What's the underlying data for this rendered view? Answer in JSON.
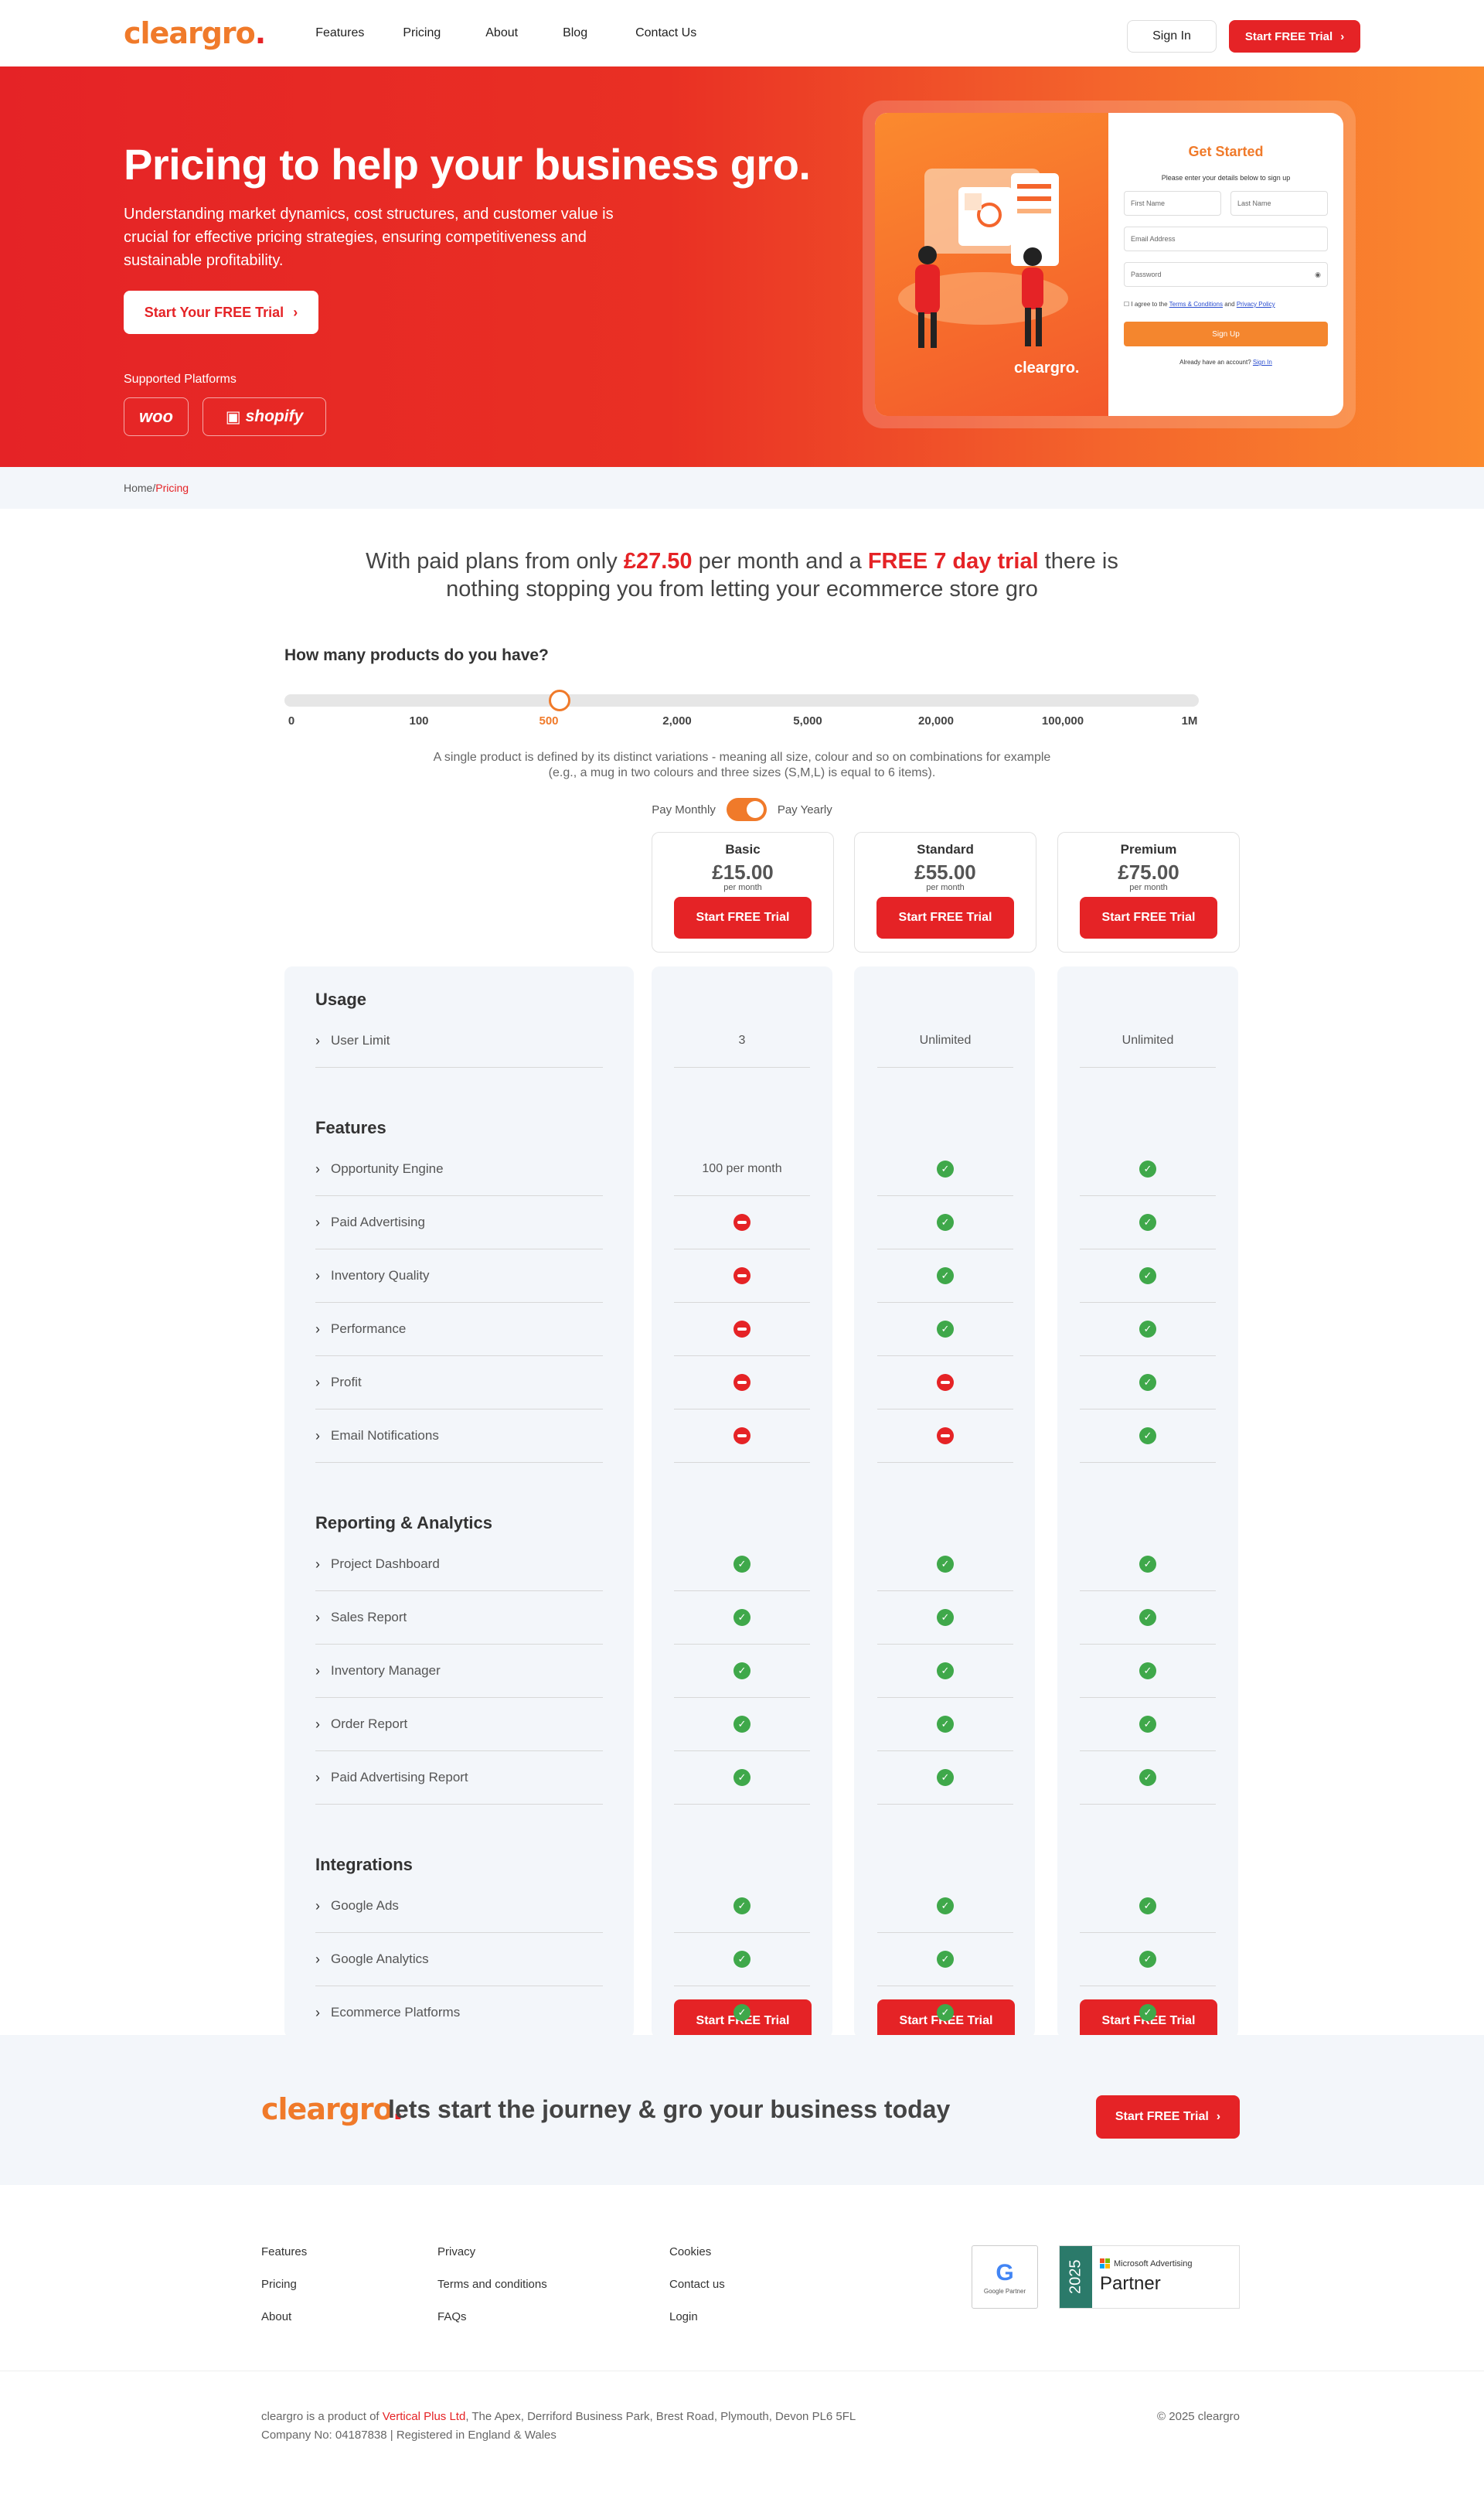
{
  "header": {
    "logo": "cleargro",
    "logo_dot": ".",
    "nav": [
      "Features",
      "Pricing",
      "About",
      "Blog",
      "Contact Us"
    ],
    "signin": "Sign In",
    "trial": "Start FREE Trial"
  },
  "hero": {
    "title": "Pricing to help your business gro.",
    "lead": "Understanding market dynamics, cost structures, and customer value is crucial for effective pricing strategies, ensuring competitiveness and sustainable profitability.",
    "cta": "Start Your FREE Trial",
    "platforms_label": "Supported Platforms",
    "platforms": [
      "woo",
      "shopify"
    ],
    "form": {
      "title": "Get Started",
      "subtitle": "Please enter your details below to sign up",
      "first_name": "First Name",
      "last_name": "Last Name",
      "email": "Email Address",
      "password": "Password",
      "terms_pre": "I agree to the",
      "terms_link": "Terms & Conditions",
      "terms_and": "and",
      "privacy_link": "Privacy Policy",
      "submit": "Sign Up",
      "login_pre": "Already have an account?",
      "login_link": "Sign In",
      "illustration_brand": "cleargro."
    }
  },
  "breadcrumb": {
    "home": "Home",
    "sep": " / ",
    "current": "Pricing"
  },
  "intro": {
    "p1": "With paid plans from only ",
    "price": "£27.50",
    "p2": " per month and a ",
    "trial": "FREE 7 day trial",
    "p3": " there is",
    "line2": "nothing stopping you from letting your ecommerce store gro"
  },
  "products": {
    "question": "How many products do you have?",
    "ticks": [
      "0",
      "100",
      "500",
      "2,000",
      "5,000",
      "20,000",
      "100,000",
      "1M"
    ],
    "selected_index": 2,
    "note_l1": "A single product is defined by its distinct variations - meaning all size, colour and so on combinations for example",
    "note_l2": "(e.g., a mug in two colours and three sizes (S,M,L) is equal to 6 items).",
    "billing_monthly": "Pay Monthly",
    "billing_yearly": "Pay Yearly",
    "billing_selected": "yearly"
  },
  "plans": [
    {
      "name": "Basic",
      "price": "£15.00",
      "per": "per month",
      "cta": "Start FREE Trial"
    },
    {
      "name": "Standard",
      "price": "£55.00",
      "per": "per month",
      "cta": "Start FREE Trial"
    },
    {
      "name": "Premium",
      "price": "£75.00",
      "per": "per month",
      "cta": "Start FREE Trial"
    }
  ],
  "sections": [
    {
      "title": "Usage",
      "rows": [
        {
          "label": "User Limit",
          "values": [
            "3",
            "Unlimited",
            "Unlimited"
          ]
        }
      ]
    },
    {
      "title": "Features",
      "rows": [
        {
          "label": "Opportunity Engine",
          "values": [
            "100 per month",
            "yes",
            "yes"
          ]
        },
        {
          "label": "Paid Advertising",
          "values": [
            "no",
            "yes",
            "yes"
          ]
        },
        {
          "label": "Inventory Quality",
          "values": [
            "no",
            "yes",
            "yes"
          ]
        },
        {
          "label": "Performance",
          "values": [
            "no",
            "yes",
            "yes"
          ]
        },
        {
          "label": "Profit",
          "values": [
            "no",
            "no",
            "yes"
          ]
        },
        {
          "label": "Email Notifications",
          "values": [
            "no",
            "no",
            "yes"
          ]
        }
      ]
    },
    {
      "title": "Reporting & Analytics",
      "rows": [
        {
          "label": "Project Dashboard",
          "values": [
            "yes",
            "yes",
            "yes"
          ]
        },
        {
          "label": "Sales Report",
          "values": [
            "yes",
            "yes",
            "yes"
          ]
        },
        {
          "label": "Inventory Manager",
          "values": [
            "yes",
            "yes",
            "yes"
          ]
        },
        {
          "label": "Order Report",
          "values": [
            "yes",
            "yes",
            "yes"
          ]
        },
        {
          "label": "Paid Advertising Report",
          "values": [
            "yes",
            "yes",
            "yes"
          ]
        }
      ]
    },
    {
      "title": "Integrations",
      "rows": [
        {
          "label": "Google Ads",
          "values": [
            "yes",
            "yes",
            "yes"
          ]
        },
        {
          "label": "Google Analytics",
          "values": [
            "yes",
            "yes",
            "yes"
          ]
        },
        {
          "label": "Ecommerce Platforms",
          "values": [
            "yes",
            "yes",
            "yes"
          ]
        }
      ]
    }
  ],
  "banner": {
    "logo": "cleargro",
    "logo_dot": ".",
    "text": "lets start the journey & gro your business today",
    "cta": "Start FREE Trial"
  },
  "footer": {
    "col1": [
      "Features",
      "Pricing",
      "About"
    ],
    "col2": [
      "Privacy",
      "Terms and conditions",
      "FAQs"
    ],
    "col3": [
      "Cookies",
      "Contact us",
      "Login"
    ],
    "google_badge": "Google Partner",
    "ms_year": "2025",
    "ms_brand": "Microsoft Advertising",
    "ms_partner": "Partner",
    "legal_pre": "cleargro is a product of ",
    "legal_company": "Vertical Plus Ltd",
    "legal_post": ", The Apex, Derriford Business Park, Brest Road, Plymouth, Devon PL6 5FL",
    "legal_l2": "Company No: 04187838 | Registered in England & Wales",
    "copyright": "© 2025 cleargro"
  },
  "colors": {
    "brand_red": "#e52326",
    "brand_orange": "#f07a2a",
    "check_green": "#3fa84a"
  }
}
